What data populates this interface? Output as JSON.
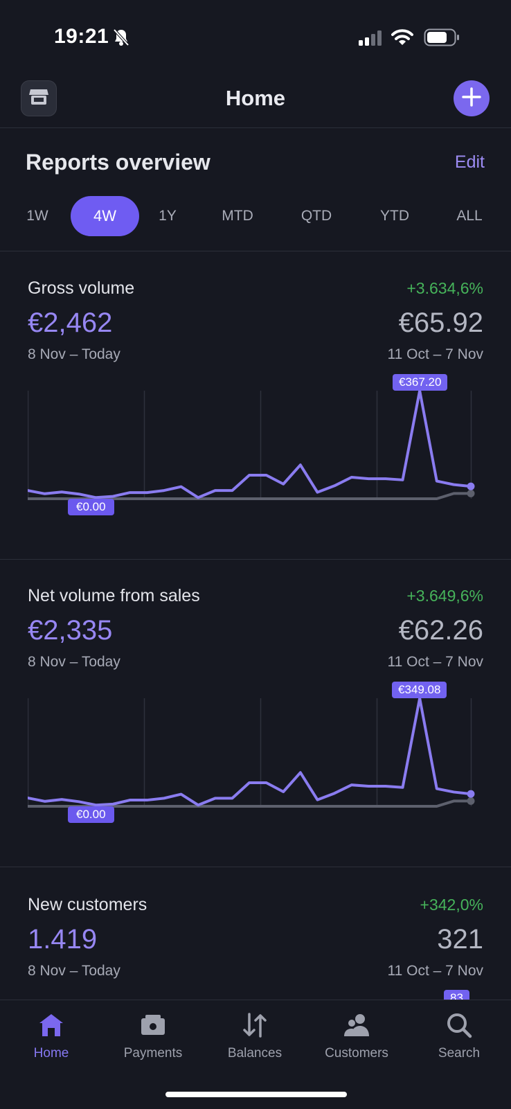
{
  "status": {
    "time": "19:21"
  },
  "header": {
    "title": "Home"
  },
  "overview": {
    "title": "Reports overview",
    "edit_label": "Edit",
    "ranges": [
      "1W",
      "4W",
      "1Y",
      "MTD",
      "QTD",
      "YTD",
      "ALL"
    ],
    "active_range": "4W"
  },
  "cards": [
    {
      "title": "Gross volume",
      "change": "+3.634,6%",
      "current_value": "€2,462",
      "previous_value": "€65.92",
      "current_period": "8 Nov – Today",
      "previous_period": "11 Oct – 7 Nov",
      "max_label": "€367.20",
      "min_label": "€0.00"
    },
    {
      "title": "Net volume from sales",
      "change": "+3.649,6%",
      "current_value": "€2,335",
      "previous_value": "€62.26",
      "current_period": "8 Nov – Today",
      "previous_period": "11 Oct – 7 Nov",
      "max_label": "€349.08",
      "min_label": "€0.00"
    },
    {
      "title": "New customers",
      "change": "+342,0%",
      "current_value": "1.419",
      "previous_value": "321",
      "current_period": "8 Nov – Today",
      "previous_period": "11 Oct – 7 Nov",
      "max_label": "83"
    }
  ],
  "chart_data": [
    {
      "type": "line",
      "series": [
        {
          "values": [
            28,
            17,
            23,
            16,
            4,
            8,
            21,
            21,
            28,
            41,
            4,
            28,
            28,
            80,
            80,
            50,
            115,
            22,
            44,
            73,
            68,
            68,
            64,
            367.2,
            60,
            48,
            42
          ]
        },
        {
          "values": [
            0,
            0,
            0,
            0,
            0,
            0,
            0,
            0,
            0,
            0,
            0,
            0,
            0,
            0,
            0,
            0,
            0,
            0,
            0,
            0,
            0,
            0,
            0,
            0,
            0,
            18,
            18
          ]
        }
      ],
      "ylim": [
        0,
        367.2
      ],
      "colors": [
        "#8a7cf0",
        "#5d606d"
      ]
    },
    {
      "type": "line",
      "series": [
        {
          "values": [
            27,
            16,
            22,
            15,
            4,
            7,
            20,
            20,
            26,
            39,
            4,
            26,
            26,
            76,
            76,
            47,
            109,
            21,
            42,
            69,
            65,
            65,
            61,
            349.08,
            57,
            46,
            40
          ]
        },
        {
          "values": [
            0,
            0,
            0,
            0,
            0,
            0,
            0,
            0,
            0,
            0,
            0,
            0,
            0,
            0,
            0,
            0,
            0,
            0,
            0,
            0,
            0,
            0,
            0,
            0,
            0,
            17,
            17
          ]
        }
      ],
      "ylim": [
        0,
        349.08
      ],
      "colors": [
        "#8a7cf0",
        "#5d606d"
      ]
    }
  ],
  "tabs": [
    {
      "label": "Home",
      "icon": "home-icon",
      "active": true
    },
    {
      "label": "Payments",
      "icon": "payments-icon",
      "active": false
    },
    {
      "label": "Balances",
      "icon": "balances-icon",
      "active": false
    },
    {
      "label": "Customers",
      "icon": "customers-icon",
      "active": false
    },
    {
      "label": "Search",
      "icon": "search-icon",
      "active": false
    }
  ]
}
